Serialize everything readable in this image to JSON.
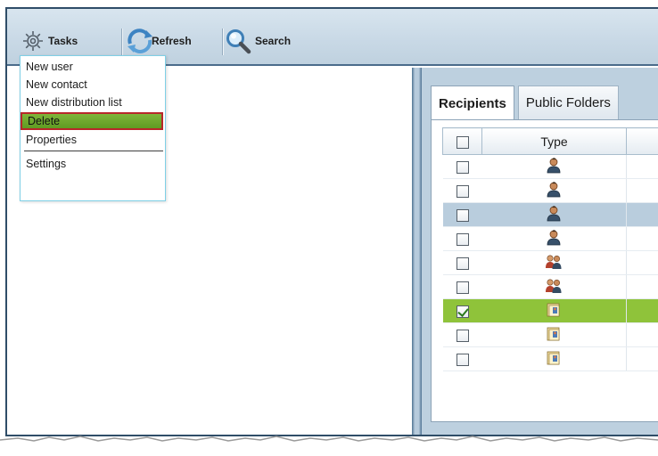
{
  "toolbar": {
    "tasks_label": "Tasks",
    "refresh_label": "Refresh",
    "search_label": "Search",
    "tasks_icon": "gear-icon",
    "refresh_icon": "refresh-icon",
    "search_icon": "magnifier-icon"
  },
  "menu": {
    "items": [
      {
        "label": "New user"
      },
      {
        "label": "New contact"
      },
      {
        "label": "New distribution list"
      },
      {
        "label": "Delete",
        "highlighted": true
      },
      {
        "label": "Properties"
      },
      {
        "label": "Settings"
      }
    ]
  },
  "tabs": [
    {
      "label": "Recipients",
      "active": true
    },
    {
      "label": "Public Folders",
      "active": false
    }
  ],
  "grid": {
    "columns": {
      "type": "Type"
    },
    "rows": [
      {
        "icon": "user-icon",
        "checked": false,
        "state": "normal"
      },
      {
        "icon": "user-icon",
        "checked": false,
        "state": "normal"
      },
      {
        "icon": "user-icon",
        "checked": false,
        "state": "hover"
      },
      {
        "icon": "user-icon",
        "checked": false,
        "state": "normal"
      },
      {
        "icon": "group-icon",
        "checked": false,
        "state": "normal"
      },
      {
        "icon": "group-icon",
        "checked": false,
        "state": "normal"
      },
      {
        "icon": "distribution-list-icon",
        "checked": true,
        "state": "selected"
      },
      {
        "icon": "distribution-list-icon",
        "checked": false,
        "state": "normal"
      },
      {
        "icon": "distribution-list-icon",
        "checked": false,
        "state": "normal"
      }
    ]
  },
  "colors": {
    "selected_row": "#8fc33a",
    "hover_row": "#b9cddd",
    "menu_highlight": "#6aa82a",
    "menu_highlight_border": "#b7272a",
    "frame_border": "#2f4d68"
  }
}
